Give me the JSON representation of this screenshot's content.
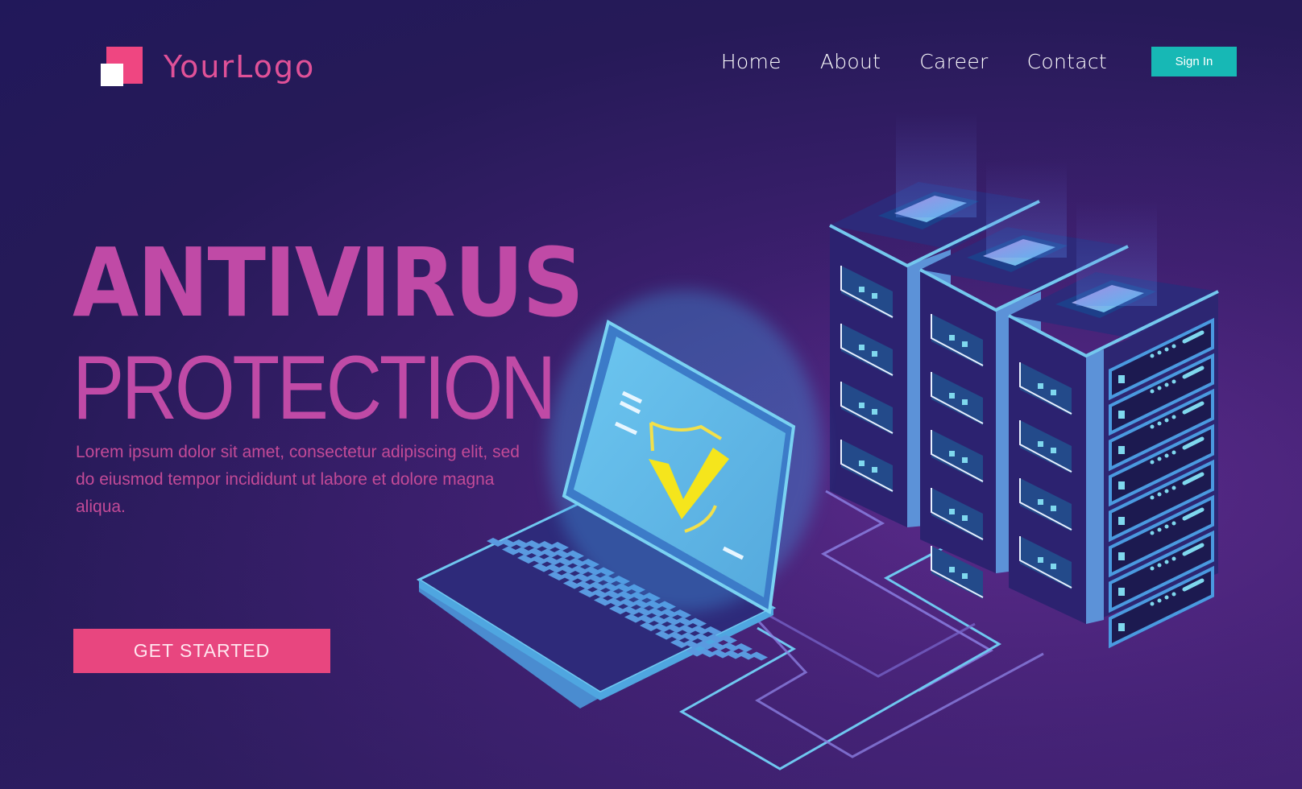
{
  "header": {
    "logo_text": "YourLogo",
    "nav": [
      {
        "label": "Home"
      },
      {
        "label": "About"
      },
      {
        "label": "Career"
      },
      {
        "label": "Contact"
      }
    ],
    "signin_label": "Sign In"
  },
  "hero": {
    "title_line1": "ANTIVIRUS",
    "title_line2": "PROTECTION",
    "description": "Lorem ipsum dolor sit amet, consectetur adipiscing elit, sed do eiusmod tempor incididunt ut labore et dolore magna aliqua.",
    "cta_label": "GET STARTED"
  },
  "illustration": {
    "laptop_screen_icon": "shield-check-icon",
    "server_racks": 3
  },
  "colors": {
    "brand_pink": "#ef4681",
    "title_magenta": "#c04aa6",
    "signin_teal": "#17b8b5",
    "cta_pink": "#e8467f",
    "screen_blue": "#5bb4e4",
    "check_yellow": "#f5e51c"
  }
}
